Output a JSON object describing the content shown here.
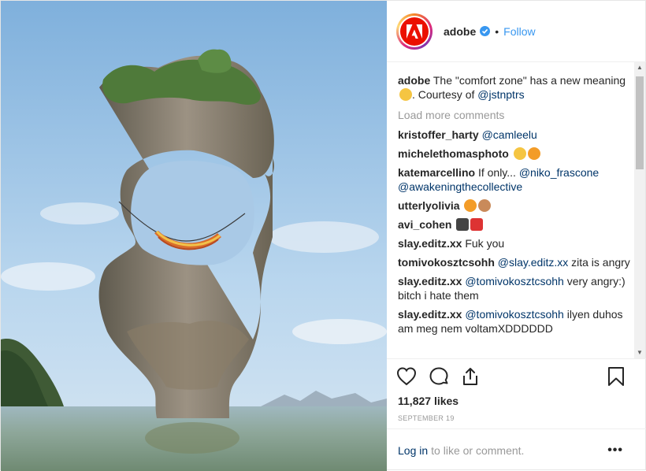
{
  "header": {
    "username": "adobe",
    "separator": "•",
    "follow_label": "Follow"
  },
  "caption": {
    "username": "adobe",
    "text_before": "The \"comfort zone\" has a new meaning",
    "text_after": ". Courtesy of",
    "mention": "@jstnptrs"
  },
  "load_more": "Load more comments",
  "comments": [
    {
      "user": "kristoffer_harty",
      "mention": "@camleelu",
      "text": ""
    },
    {
      "user": "michelethomasphoto",
      "mention": "",
      "text": ""
    },
    {
      "user": "katemarcellino",
      "mention": "",
      "text": "If only...",
      "mention2": "@niko_frascone",
      "mention3": "@awakeningthecollective"
    },
    {
      "user": "utterlyolivia",
      "mention": "",
      "text": ""
    },
    {
      "user": "avi_cohen",
      "mention": "",
      "text": ""
    },
    {
      "user": "slay.editz.xx",
      "mention": "",
      "text": "Fuk you"
    },
    {
      "user": "tomivokosztcsohh",
      "mention": "@slay.editz.xx",
      "text": "zita is angry"
    },
    {
      "user": "slay.editz.xx",
      "mention": "@tomivokosztcsohh",
      "text": "very angry:) bitch i hate them"
    },
    {
      "user": "slay.editz.xx",
      "mention": "@tomivokosztcsohh",
      "text": "ilyen duhos am meg nem voltamXDDDDDD"
    }
  ],
  "likes": "11,827 likes",
  "date": "SEPTEMBER 19",
  "footer": {
    "login_label": "Log in",
    "rest": "to like or comment.",
    "more": "•••"
  },
  "icons": [
    "heart-icon",
    "comment-icon",
    "share-icon",
    "bookmark-icon",
    "verified-icon",
    "adobe-logo-icon"
  ],
  "colors": {
    "link": "#003569",
    "follow": "#3897f0",
    "adobe_red": "#eb1000"
  }
}
